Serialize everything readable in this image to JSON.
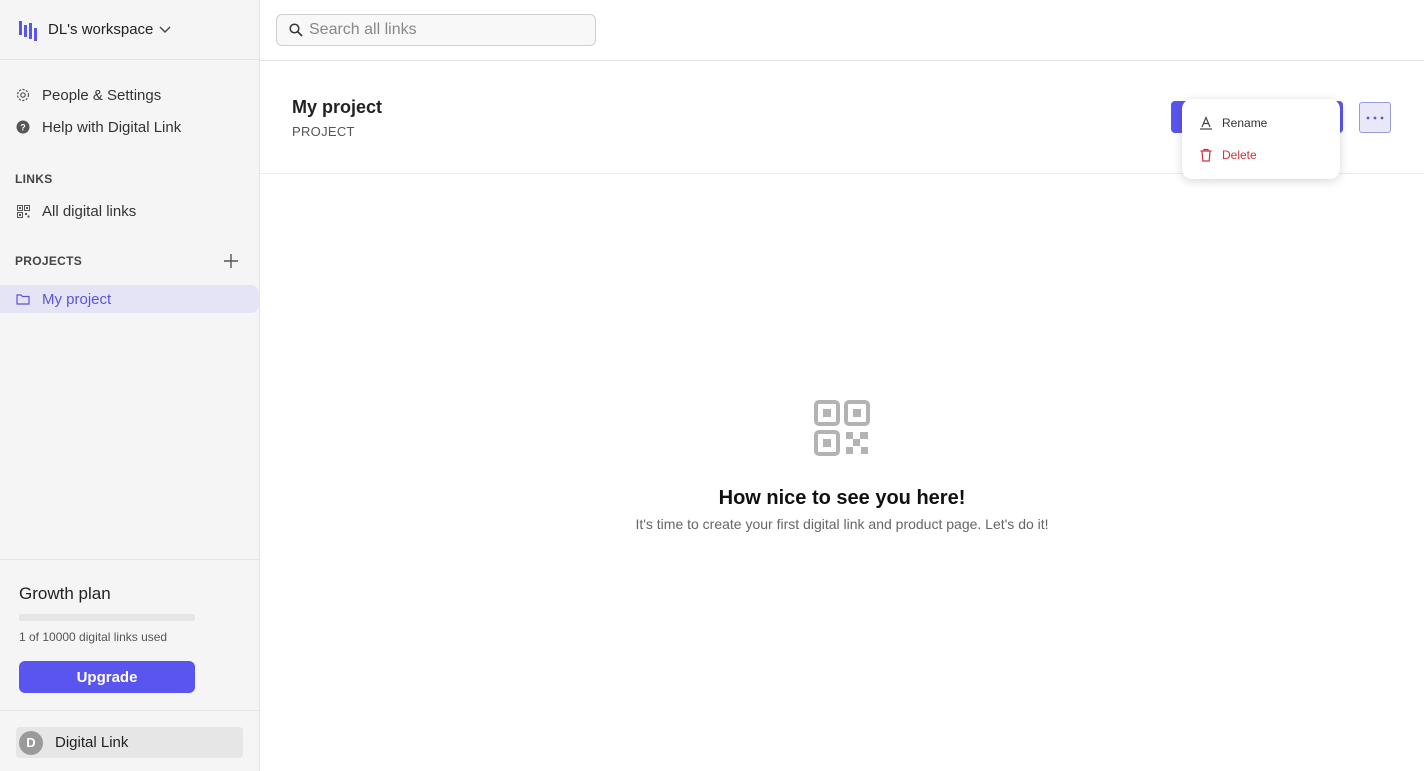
{
  "workspace": {
    "name": "DL's workspace"
  },
  "sidebar": {
    "settings_label": "People & Settings",
    "help_label": "Help with Digital Link",
    "links_section": "LINKS",
    "all_links_label": "All digital links",
    "projects_section": "PROJECTS",
    "projects": [
      {
        "label": "My project"
      }
    ]
  },
  "plan": {
    "title": "Growth plan",
    "usage_text": "1 of 10000 digital links used",
    "used": 1,
    "limit": 10000,
    "upgrade_label": "Upgrade"
  },
  "user": {
    "initial": "D",
    "name": "Digital Link"
  },
  "search": {
    "placeholder": "Search all links"
  },
  "project": {
    "title": "My project",
    "subtitle": "PROJECT"
  },
  "menu": {
    "rename_label": "Rename",
    "delete_label": "Delete"
  },
  "empty_state": {
    "title": "How nice to see you here!",
    "subtitle": "It's time to create your first digital link and product page. Let's do it!"
  },
  "colors": {
    "accent": "#5b55f0",
    "danger": "#d0323c",
    "selected_bg": "#e4e4f6"
  }
}
